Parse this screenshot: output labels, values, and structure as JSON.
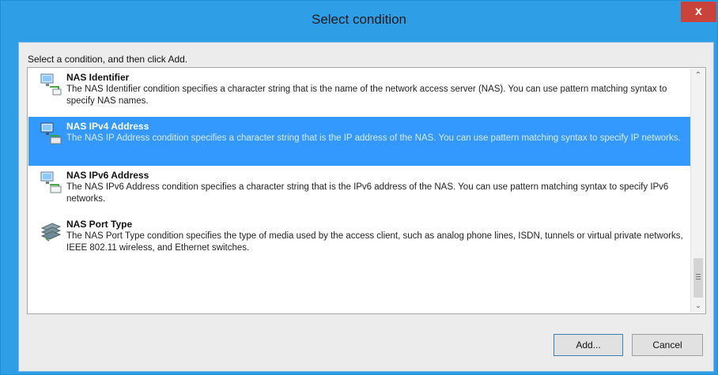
{
  "window": {
    "title": "Select condition",
    "close_label": "x"
  },
  "prompt": "Select a condition, and then click Add.",
  "conditions": [
    {
      "title": "NAS Identifier",
      "description": "The NAS Identifier condition specifies a character string that is the name of the network access server (NAS). You can use pattern matching syntax to specify NAS names.",
      "icon": "network-computer-icon",
      "selected": false
    },
    {
      "title": "NAS IPv4 Address",
      "description": "The NAS IP Address condition specifies a character string that is the IP address of the NAS. You can use pattern matching syntax to specify IP networks.",
      "icon": "network-ipv4-icon",
      "selected": true
    },
    {
      "title": "NAS IPv6 Address",
      "description": "The NAS IPv6 Address condition specifies a character string that is the IPv6 address of the NAS. You can use pattern matching syntax to specify IPv6 networks.",
      "icon": "network-ipv6-icon",
      "selected": false
    },
    {
      "title": "NAS Port Type",
      "description": "The NAS Port Type condition specifies the type of media used by the access client, such as analog phone lines, ISDN, tunnels or virtual private networks, IEEE 802.11 wireless, and Ethernet switches.",
      "icon": "network-switch-icon",
      "selected": false
    }
  ],
  "buttons": {
    "add": "Add...",
    "cancel": "Cancel"
  },
  "colors": {
    "title_bar": "#2e9ee6",
    "selection": "#3399ff",
    "close_button": "#c9433a"
  }
}
